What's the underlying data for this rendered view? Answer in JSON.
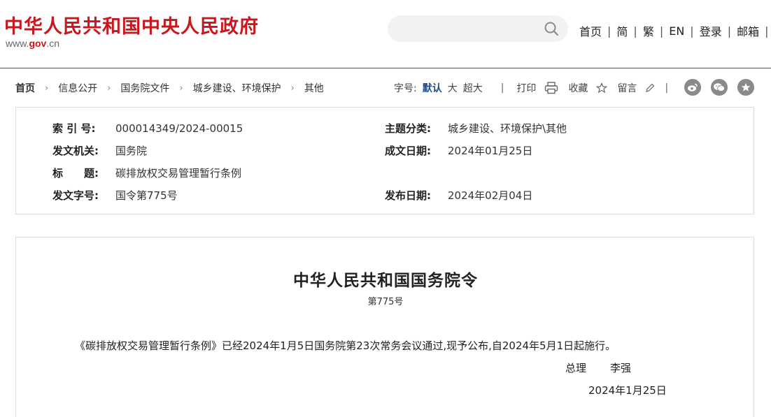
{
  "header": {
    "site_title": "中华人民共和国中央人民政府",
    "domain_prefix": "www.",
    "domain_gov": "gov",
    "domain_suffix": ".cn",
    "search": {
      "placeholder": ""
    },
    "nav": [
      "首页",
      "简",
      "繁",
      "EN",
      "登录",
      "邮箱"
    ],
    "nav_separator": "|",
    "brand_color": "#c8171e"
  },
  "breadcrumb": {
    "items": [
      "首页",
      "信息公开",
      "国务院文件",
      "城乡建设、环境保护",
      "其他"
    ],
    "arrow": "›"
  },
  "tools": {
    "font_size_label": "字号:",
    "font_default": "默认",
    "font_large": "大",
    "font_xlarge": "超大",
    "separator": "|",
    "print": "打印",
    "favorite": "收藏",
    "comment": "留言"
  },
  "social_icons": [
    "weibo-icon",
    "wechat-icon",
    "star-icon"
  ],
  "info": {
    "index_no_label": "索 引 号:",
    "index_no": "000014349/2024-00015",
    "category_label": "主题分类:",
    "category": "城乡建设、环境保护\\其他",
    "issuer_label": "发文机关:",
    "issuer": "国务院",
    "written_date_label": "成文日期:",
    "written_date": "2024年01月25日",
    "title_label": "标　　题:",
    "title": "碳排放权交易管理暂行条例",
    "doc_number_label": "发文字号:",
    "doc_number": "国令第775号",
    "publish_date_label": "发布日期:",
    "publish_date": "2024年02月04日"
  },
  "document": {
    "title": "中华人民共和国国务院令",
    "number": "第775号",
    "paragraph": "《碳排放权交易管理暂行条例》已经2024年1月5日国务院第23次常务会议通过,现予公布,自2024年5月1日起施行。",
    "signer_title": "总理",
    "signer_name": "李强",
    "date": "2024年1月25日"
  }
}
